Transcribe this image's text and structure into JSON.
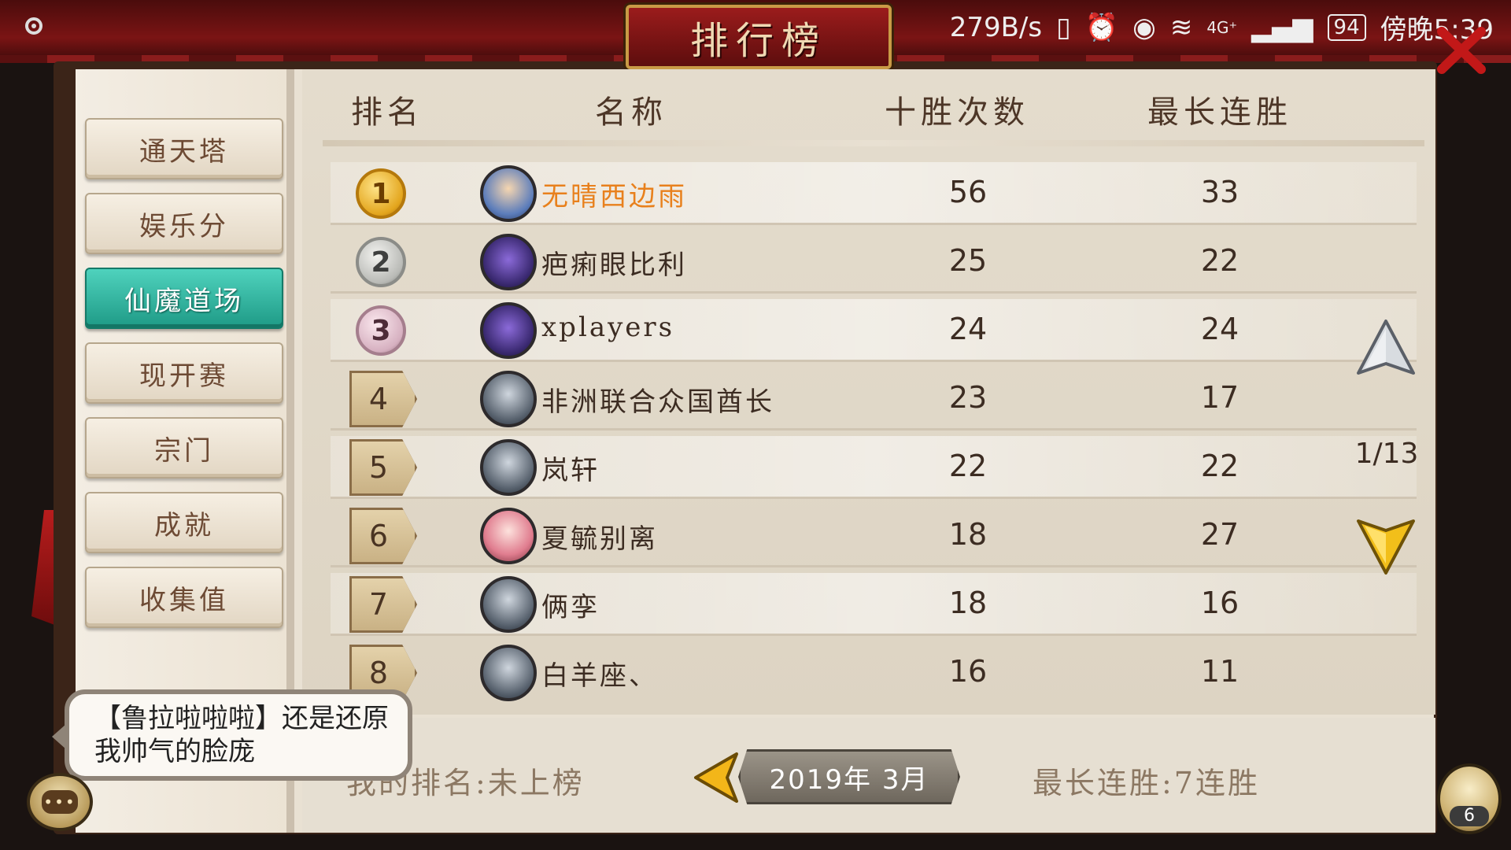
{
  "title": "排行榜",
  "status_bar": {
    "net_speed": "279B/s",
    "network": "4G⁺",
    "battery": "94",
    "time": "傍晚5:39"
  },
  "sidebar": {
    "items": [
      {
        "label": "通天塔",
        "active": false
      },
      {
        "label": "娱乐分",
        "active": false
      },
      {
        "label": "仙魔道场",
        "active": true
      },
      {
        "label": "现开赛",
        "active": false
      },
      {
        "label": "宗门",
        "active": false
      },
      {
        "label": "成就",
        "active": false
      },
      {
        "label": "收集值",
        "active": false
      }
    ]
  },
  "table": {
    "headers": {
      "rank": "排名",
      "name": "名称",
      "wins": "十胜次数",
      "streak": "最长连胜"
    },
    "rows": [
      {
        "rank": "1",
        "name": "无晴西边雨",
        "wins": "56",
        "streak": "33"
      },
      {
        "rank": "2",
        "name": "疤痢眼比利",
        "wins": "25",
        "streak": "22"
      },
      {
        "rank": "3",
        "name": "xplayers",
        "wins": "24",
        "streak": "24"
      },
      {
        "rank": "4",
        "name": "非洲联合众国酋长",
        "wins": "23",
        "streak": "17"
      },
      {
        "rank": "5",
        "name": "岚轩",
        "wins": "22",
        "streak": "22"
      },
      {
        "rank": "6",
        "name": "夏毓别离",
        "wins": "18",
        "streak": "27"
      },
      {
        "rank": "7",
        "name": "俩孪",
        "wins": "18",
        "streak": "16"
      },
      {
        "rank": "8",
        "name": "白羊座、",
        "wins": "16",
        "streak": "11"
      }
    ]
  },
  "pager": "1/13",
  "footer": {
    "my_rank": "我的排名:未上榜",
    "date": "2019年  3月",
    "best_streak": "最长连胜:7连胜"
  },
  "chat": {
    "message": "【鲁拉啦啦啦】还是还原我帅气的脸庞",
    "button_label": "•••"
  },
  "friends_count": "6",
  "colors": {
    "accent_teal": "#2fb8a2",
    "top_name_orange": "#e8801c",
    "curtain_red": "#7a1414"
  }
}
